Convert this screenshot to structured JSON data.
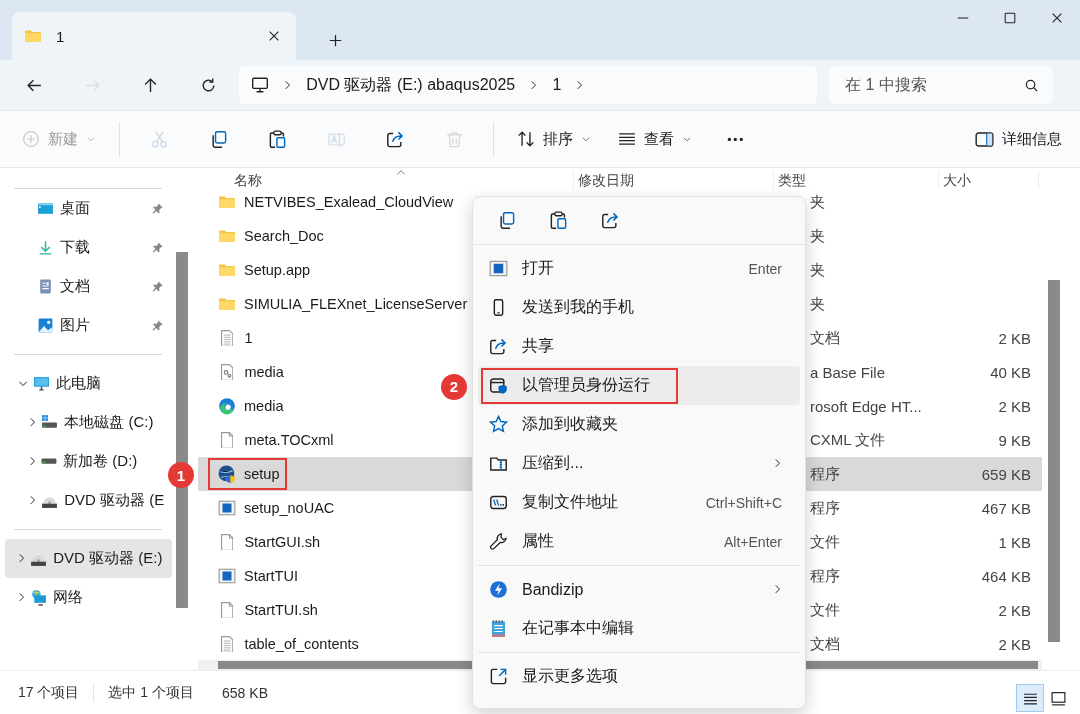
{
  "window": {
    "tab": {
      "title": "1"
    }
  },
  "nav_buttons": [
    {
      "disabled": false
    },
    {
      "disabled": true
    },
    {
      "disabled": false
    },
    {
      "disabled": false
    }
  ],
  "address": {
    "segments": [
      "DVD 驱动器 (E:) abaqus2025",
      "1"
    ]
  },
  "search": {
    "placeholder": "在 1 中搜索"
  },
  "toolbar": {
    "items": [
      {
        "kind": "menu",
        "label": "新建",
        "disabled": true
      },
      {
        "kind": "icon",
        "disabled": true
      },
      {
        "kind": "icon",
        "disabled": false
      },
      {
        "kind": "icon",
        "disabled": false
      },
      {
        "kind": "icon",
        "disabled": true
      },
      {
        "kind": "icon",
        "disabled": false
      },
      {
        "kind": "icon",
        "disabled": true
      },
      {
        "kind": "menu",
        "label": "排序",
        "disabled": false
      },
      {
        "kind": "menu",
        "label": "查看",
        "disabled": false
      },
      {
        "kind": "icon",
        "disabled": false
      }
    ],
    "details": {
      "label": "详细信息"
    }
  },
  "sidebar": {
    "groups": [
      {
        "items": [
          {
            "label": "桌面",
            "pinned": true,
            "selected": false
          },
          {
            "label": "下载",
            "pinned": true,
            "selected": false
          },
          {
            "label": "文档",
            "pinned": true,
            "selected": false
          },
          {
            "label": "图片",
            "pinned": true,
            "selected": false
          }
        ]
      },
      {
        "items": [
          {
            "label": "此电脑",
            "expanded": true,
            "selected": false,
            "children": [
              {
                "label": "本地磁盘 (C:)",
                "expanded": false,
                "selected": false
              },
              {
                "label": "新加卷 (D:)",
                "expanded": false,
                "selected": false
              },
              {
                "label": "DVD 驱动器 (E",
                "expanded": false,
                "selected": false
              }
            ]
          }
        ]
      },
      {
        "items": [
          {
            "label": "DVD 驱动器 (E:)",
            "expanded": false,
            "selected": true
          },
          {
            "label": "网络",
            "expanded": false,
            "selected": false
          }
        ]
      }
    ]
  },
  "files": {
    "columns": [
      "名称",
      "修改日期",
      "类型",
      "大小"
    ],
    "rows": [
      {
        "kind": "folder",
        "name": "NETVIBES_Exalead_CloudView",
        "type": "夹",
        "selected": false
      },
      {
        "kind": "folder",
        "name": "Search_Doc",
        "type": "夹",
        "selected": false
      },
      {
        "kind": "folder",
        "name": "Setup.app",
        "type": "夹",
        "selected": false
      },
      {
        "kind": "folder",
        "name": "SIMULIA_FLEXnet_LicenseServer",
        "type": "夹",
        "selected": false
      },
      {
        "kind": "file",
        "name": "1",
        "type": "文档",
        "size": "2 KB",
        "selected": false
      },
      {
        "kind": "file",
        "name": "media",
        "type": "a Base File",
        "size": "40 KB",
        "selected": false
      },
      {
        "kind": "file",
        "name": "media",
        "type": "rosoft Edge HT...",
        "size": "2 KB",
        "selected": false
      },
      {
        "kind": "file",
        "name": "meta.TOCxml",
        "type": "CXML 文件",
        "size": "9 KB",
        "selected": false
      },
      {
        "kind": "file",
        "name": "setup",
        "type": "程序",
        "size": "659 KB",
        "selected": true,
        "annotation": "1"
      },
      {
        "kind": "file",
        "name": "setup_noUAC",
        "type": "程序",
        "size": "467 KB",
        "selected": false
      },
      {
        "kind": "file",
        "name": "StartGUI.sh",
        "type": "文件",
        "size": "1 KB",
        "selected": false
      },
      {
        "kind": "file",
        "name": "StartTUI",
        "type": "程序",
        "size": "464 KB",
        "selected": false
      },
      {
        "kind": "file",
        "name": "StartTUI.sh",
        "type": "文件",
        "size": "2 KB",
        "selected": false
      },
      {
        "kind": "file",
        "name": "table_of_contents",
        "type": "文档",
        "size": "2 KB",
        "selected": false
      }
    ]
  },
  "context_menu": {
    "groups": [
      [
        {
          "label": "打开",
          "shortcut": "Enter",
          "highlighted": false
        },
        {
          "label": "发送到我的手机",
          "highlighted": false
        },
        {
          "label": "共享",
          "highlighted": false
        },
        {
          "label": "以管理员身份运行",
          "highlighted": true,
          "annotation": "2"
        },
        {
          "label": "添加到收藏夹",
          "highlighted": false
        },
        {
          "label": "压缩到...",
          "submenu": true,
          "highlighted": false
        },
        {
          "label": "复制文件地址",
          "shortcut": "Ctrl+Shift+C",
          "highlighted": false
        },
        {
          "label": "属性",
          "shortcut": "Alt+Enter",
          "highlighted": false
        }
      ],
      [
        {
          "label": "Bandizip",
          "submenu": true,
          "highlighted": false
        },
        {
          "label": "在记事本中编辑",
          "highlighted": false
        }
      ],
      [
        {
          "label": "显示更多选项",
          "highlighted": false
        }
      ]
    ]
  },
  "status_bar": {
    "item_count": "17 个项目",
    "selection": "选中 1 个项目",
    "size": "658 KB",
    "views": [
      {
        "selected": true
      },
      {
        "selected": false
      }
    ]
  }
}
